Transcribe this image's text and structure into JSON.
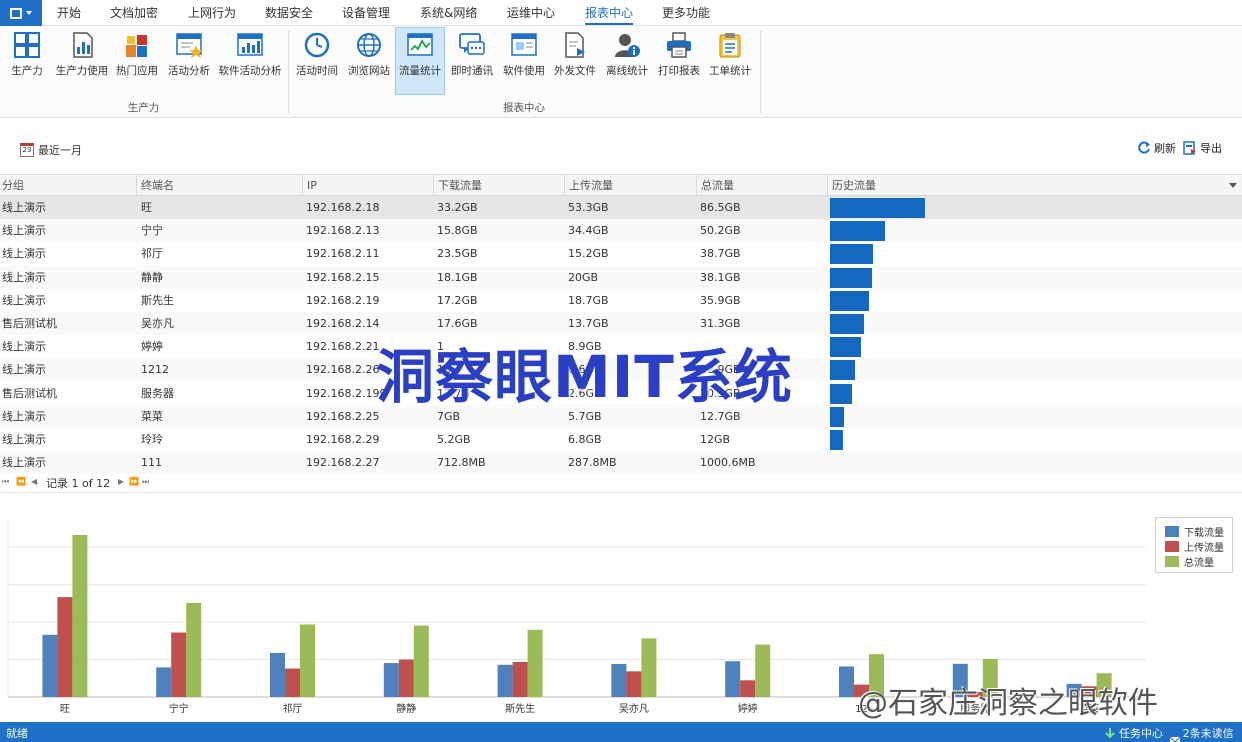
{
  "menu": {
    "tabs": [
      {
        "label": "开始"
      },
      {
        "label": "文档加密"
      },
      {
        "label": "上网行为"
      },
      {
        "label": "数据安全"
      },
      {
        "label": "设备管理"
      },
      {
        "label": "系统&网络"
      },
      {
        "label": "运维中心"
      },
      {
        "label": "报表中心"
      },
      {
        "label": "更多功能"
      }
    ]
  },
  "ribbon": {
    "buttons": [
      {
        "label": "生产力",
        "icon": "grid-icon"
      },
      {
        "label": "生产力使用",
        "icon": "doc-chart-icon"
      },
      {
        "label": "热门应用",
        "icon": "blocks-icon"
      },
      {
        "label": "活动分析",
        "icon": "window-star-icon"
      },
      {
        "label": "软件活动分析",
        "icon": "window-chart-icon"
      },
      {
        "label": "活动时间",
        "icon": "clock-icon"
      },
      {
        "label": "浏览网站",
        "icon": "globe-icon"
      },
      {
        "label": "流量统计",
        "icon": "traffic-chart-icon"
      },
      {
        "label": "即时通讯",
        "icon": "chat-icon"
      },
      {
        "label": "软件使用",
        "icon": "window-app-icon"
      },
      {
        "label": "外发文件",
        "icon": "file-send-icon"
      },
      {
        "label": "离线统计",
        "icon": "user-info-icon"
      },
      {
        "label": "打印报表",
        "icon": "printer-icon"
      },
      {
        "label": "工单统计",
        "icon": "clipboard-icon"
      }
    ],
    "groups": [
      {
        "label": "生产力"
      },
      {
        "label": "报表中心"
      }
    ]
  },
  "toolbar": {
    "date_range": "最近一月",
    "calendar_day": "23",
    "refresh": "刷新",
    "export": "导出"
  },
  "table": {
    "columns": [
      "分组",
      "终端名",
      "IP",
      "下载流量",
      "上传流量",
      "总流量",
      "历史流量"
    ],
    "rows": [
      {
        "group": "线上演示",
        "name": "旺",
        "ip": "192.168.2.18",
        "down": "33.2GB",
        "up": "53.3GB",
        "total": "86.5GB",
        "total_gb": 86.5
      },
      {
        "group": "线上演示",
        "name": "宁宁",
        "ip": "192.168.2.13",
        "down": "15.8GB",
        "up": "34.4GB",
        "total": "50.2GB",
        "total_gb": 50.2
      },
      {
        "group": "线上演示",
        "name": "祁厅",
        "ip": "192.168.2.11",
        "down": "23.5GB",
        "up": "15.2GB",
        "total": "38.7GB",
        "total_gb": 38.7
      },
      {
        "group": "线上演示",
        "name": "静静",
        "ip": "192.168.2.15",
        "down": "18.1GB",
        "up": "20GB",
        "total": "38.1GB",
        "total_gb": 38.1
      },
      {
        "group": "线上演示",
        "name": "斯先生",
        "ip": "192.168.2.19",
        "down": "17.2GB",
        "up": "18.7GB",
        "total": "35.9GB",
        "total_gb": 35.9
      },
      {
        "group": "售后测试机",
        "name": "吴亦凡",
        "ip": "192.168.2.14",
        "down": "17.6GB",
        "up": "13.7GB",
        "total": "31.3GB",
        "total_gb": 31.3
      },
      {
        "group": "线上演示",
        "name": "婷婷",
        "ip": "192.168.2.21",
        "down": "1",
        "up": "8.9GB",
        "total": "",
        "total_gb": 28
      },
      {
        "group": "线上演示",
        "name": "1212",
        "ip": "192.168.2.26",
        "down": "16",
        "up": "6.6GB",
        "total": "22.9GB",
        "total_gb": 22.9
      },
      {
        "group": "售后测试机",
        "name": "服务器",
        "ip": "192.168.2.199",
        "down": "17.7G",
        "up": "2.6GB",
        "total": "20.3GB",
        "total_gb": 20.3
      },
      {
        "group": "线上演示",
        "name": "菜菜",
        "ip": "192.168.2.25",
        "down": "7GB",
        "up": "5.7GB",
        "total": "12.7GB",
        "total_gb": 12.7
      },
      {
        "group": "线上演示",
        "name": "玲玲",
        "ip": "192.168.2.29",
        "down": "5.2GB",
        "up": "6.8GB",
        "total": "12GB",
        "total_gb": 12
      },
      {
        "group": "线上演示",
        "name": "111",
        "ip": "192.168.2.27",
        "down": "712.8MB",
        "up": "287.8MB",
        "total": "1000.6MB",
        "total_gb": 0
      }
    ],
    "history_bar_color": "#1568c0"
  },
  "pager": {
    "text": "记录 1 of 12"
  },
  "chart_data": {
    "type": "bar",
    "categories": [
      "旺",
      "宁宁",
      "祁厅",
      "静静",
      "斯先生",
      "吴亦凡",
      "婷婷",
      "1212",
      "服务器",
      "菜菜"
    ],
    "category_labels_shown": [
      "旺",
      "宁宁",
      "祁厅",
      "静静",
      "斯先生",
      "吴亦凡",
      "婷婷",
      "12",
      "服务器",
      "菜菜"
    ],
    "series": [
      {
        "name": "下载流量",
        "color": "#4f81bd",
        "values": [
          33.2,
          15.8,
          23.5,
          18.1,
          17.2,
          17.6,
          19.1,
          16.3,
          17.7,
          7
        ]
      },
      {
        "name": "上传流量",
        "color": "#c0504d",
        "values": [
          53.3,
          34.4,
          15.2,
          20,
          18.7,
          13.7,
          8.9,
          6.6,
          2.6,
          5.7
        ]
      },
      {
        "name": "总流量",
        "color": "#9bbb59",
        "values": [
          86.5,
          50.2,
          38.7,
          38.1,
          35.9,
          31.3,
          28,
          22.9,
          20.3,
          12.7
        ]
      }
    ],
    "ylim": [
      0,
      95
    ],
    "grid": true,
    "legend": "top-right"
  },
  "watermarks": {
    "center": "洞察眼MIT系统",
    "corner": "@石家庄洞察之眼软件"
  },
  "status": {
    "text": "就绪",
    "task_center": "任务中心",
    "unread": "2条未读信息"
  }
}
